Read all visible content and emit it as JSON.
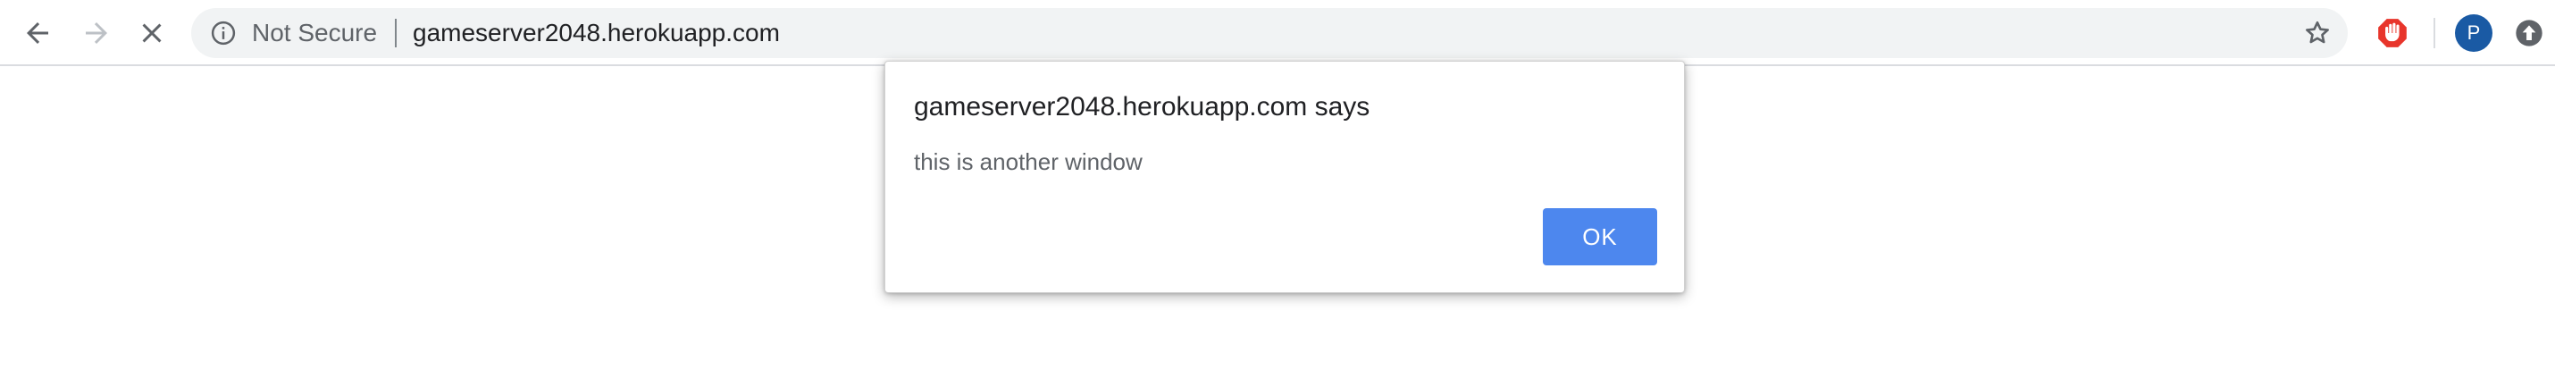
{
  "toolbar": {
    "back_icon": "arrow-left-icon",
    "forward_icon": "arrow-right-icon",
    "stop_icon": "close-icon",
    "omnibox": {
      "info_icon": "info-circle-icon",
      "security_label": "Not Secure",
      "url": "gameserver2048.herokuapp.com",
      "bookmark_icon": "star-outline-icon"
    },
    "extension_icon": "red-shield-extension-icon",
    "profile_initial": "P",
    "update_icon": "update-arrow-icon"
  },
  "dialog": {
    "title": "gameserver2048.herokuapp.com says",
    "message": "this is another window",
    "ok_label": "OK"
  },
  "colors": {
    "ok_button": "#4d87ee",
    "avatar": "#1a5aa4",
    "extension": "#e8352b",
    "omnibox_bg": "#f1f3f4"
  }
}
